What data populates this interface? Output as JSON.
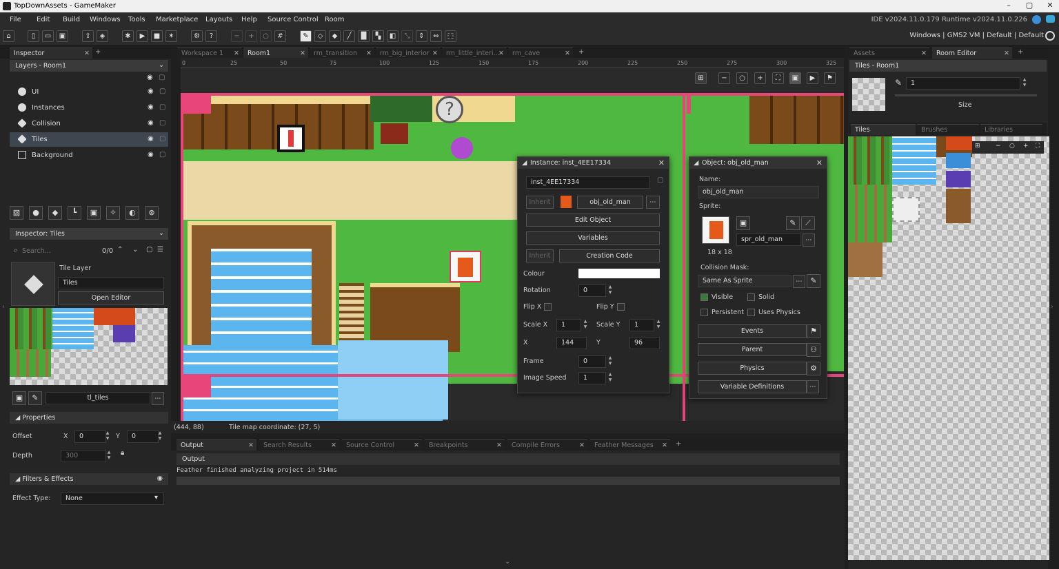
{
  "window": {
    "title": "TopDownAssets - GameMaker",
    "version": "IDE v2024.11.0.179  Runtime v2024.11.0.226"
  },
  "menu": [
    "File",
    "Edit",
    "Build",
    "Windows",
    "Tools",
    "Marketplace",
    "Layouts",
    "Help",
    "Source Control",
    "Room"
  ],
  "toolbar": {
    "config": "Windows  |  GMS2 VM  |  Default  |  Default"
  },
  "left": {
    "inspector_tab": "Inspector",
    "layers_header": "Layers - Room1",
    "layers": [
      {
        "name": "UI"
      },
      {
        "name": "Instances"
      },
      {
        "name": "Collision"
      },
      {
        "name": "Tiles"
      },
      {
        "name": "Background"
      }
    ],
    "inspector_tiles_header": "Inspector: Tiles",
    "search_placeholder": "Search...",
    "search_count": "0/0",
    "tile_layer_type": "Tile Layer",
    "tile_layer_name": "Tiles",
    "open_editor": "Open Editor",
    "tileset": "tl_tiles",
    "properties": "Properties",
    "offset_label": "Offset",
    "offset_x_label": "X",
    "offset_x": "0",
    "offset_y_label": "Y",
    "offset_y": "0",
    "depth_label": "Depth",
    "depth": "300",
    "filters": "Filters & Effects",
    "effect_type_label": "Effect Type:",
    "effect_type": "None"
  },
  "center": {
    "tabs": [
      "Workspace 1",
      "Room1",
      "rm_transition",
      "rm_big_interior",
      "rm_little_interi...",
      "rm_cave"
    ],
    "ruler": [
      "0",
      "25",
      "50",
      "75",
      "100",
      "125",
      "150",
      "175",
      "200",
      "225",
      "250",
      "275",
      "300",
      "325"
    ],
    "status_coord": "(444, 88)",
    "status_tile": "Tile map coordinate: (27, 5)"
  },
  "instance": {
    "title": "Instance: inst_4EE17334",
    "name": "inst_4EE17334",
    "inherit": "Inherit",
    "object": "obj_old_man",
    "edit_object": "Edit Object",
    "variables": "Variables",
    "creation_code": "Creation Code",
    "colour_label": "Colour",
    "rotation_label": "Rotation",
    "rotation": "0",
    "flipx_label": "Flip X",
    "flipy_label": "Flip Y",
    "scalex_label": "Scale X",
    "scalex": "1",
    "scaley_label": "Scale Y",
    "scaley": "1",
    "x_label": "X",
    "x": "144",
    "y_label": "Y",
    "y": "96",
    "frame_label": "Frame",
    "frame": "0",
    "speed_label": "Image Speed",
    "speed": "1"
  },
  "object": {
    "title": "Object: obj_old_man",
    "name_label": "Name:",
    "name": "obj_old_man",
    "sprite_label": "Sprite:",
    "sprite": "spr_old_man",
    "size": "18 x 18",
    "mask_label": "Collision Mask:",
    "mask": "Same As Sprite",
    "visible": "Visible",
    "solid": "Solid",
    "persistent": "Persistent",
    "physics": "Uses Physics",
    "events": "Events",
    "parent": "Parent",
    "physics_btn": "Physics",
    "var_defs": "Variable Definitions"
  },
  "right": {
    "tabs": [
      "Assets",
      "Room Editor"
    ],
    "header": "Tiles - Room1",
    "brush_size_value": "1",
    "size_label": "Size",
    "subtabs": [
      "Tiles",
      "Brushes",
      "Libraries"
    ]
  },
  "output": {
    "tabs": [
      "Output",
      "Search Results",
      "Source Control",
      "Breakpoints",
      "Compile Errors",
      "Feather Messages"
    ],
    "header": "Output",
    "line": "Feather finished analyzing project in 514ms"
  }
}
